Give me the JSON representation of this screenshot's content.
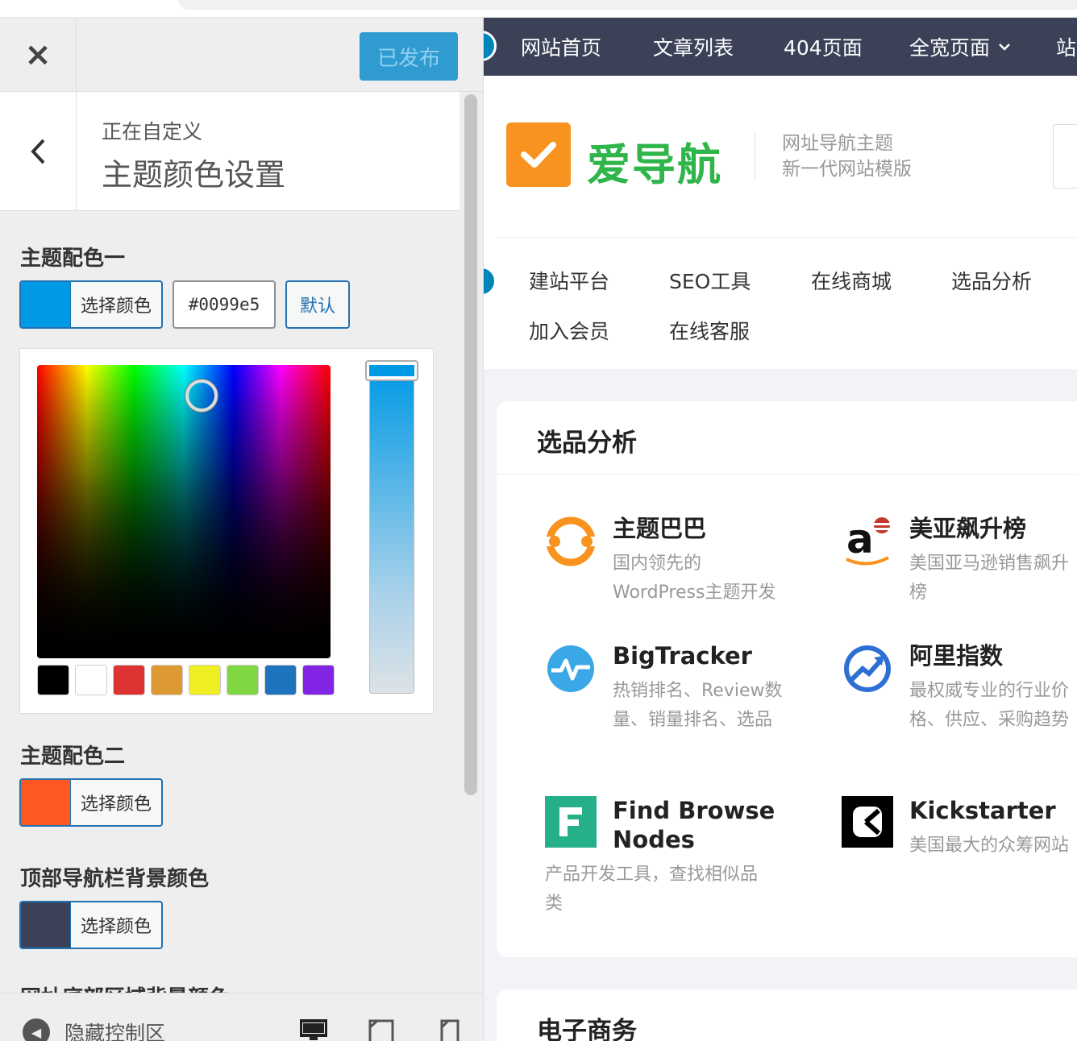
{
  "customizer": {
    "close_icon": "×",
    "publish_label": "已发布",
    "section_pre": "正在自定义",
    "section_title": "主题颜色设置",
    "color1": {
      "title": "主题配色一",
      "button_label": "选择颜色",
      "swatch": "#0099e5",
      "hex_value": "#0099e5",
      "default_label": "默认",
      "palette": [
        "#000000",
        "#ffffff",
        "#dd3333",
        "#dd9933",
        "#eeee22",
        "#81d742",
        "#1e73be",
        "#8224e3"
      ]
    },
    "color2": {
      "title": "主题配色二",
      "button_label": "选择颜色",
      "swatch": "#ff5722"
    },
    "color3": {
      "title": "顶部导航栏背景颜色",
      "button_label": "选择颜色",
      "swatch": "#3b4258"
    },
    "color4": {
      "title": "网址底部区域背景颜色"
    },
    "footer": {
      "hide_label": "隐藏控制区"
    }
  },
  "preview": {
    "nav": [
      "网站首页",
      "文章列表",
      "404页面",
      "全宽页面",
      "站"
    ],
    "logo_text": "爱导航",
    "slogan": [
      "网址导航主题",
      "新一代网站模版"
    ],
    "quick_links": [
      "建站平台",
      "SEO工具",
      "在线商城",
      "选品分析",
      "加入会员",
      "在线客服"
    ],
    "card1": {
      "title": "选品分析",
      "sites": [
        {
          "name": "主题巴巴",
          "desc": [
            "国内领先的",
            "WordPress主题开发"
          ],
          "icon": "zhutibaba-icon"
        },
        {
          "name": "美亚飙升榜",
          "desc": [
            "美国亚马逊销售飙升",
            "榜"
          ],
          "icon": "amazon-icon"
        },
        {
          "name": "BigTracker",
          "desc": [
            "热销排名、Review数",
            "量、销量排名、选品"
          ],
          "icon": "bigtracker-icon"
        },
        {
          "name": "阿里指数",
          "desc": [
            "最权威专业的行业价",
            "格、供应、采购趋势"
          ],
          "icon": "alizhishu-icon"
        },
        {
          "name": [
            "Find Browse",
            "Nodes"
          ],
          "desc": [
            "产品开发工具，查找相似品",
            "类"
          ],
          "icon": "findbrowsenodes-icon"
        },
        {
          "name": "Kickstarter",
          "desc": [
            "美国最大的众筹网站"
          ],
          "icon": "kickstarter-icon"
        }
      ]
    },
    "card2": {
      "title": "电子商务"
    }
  }
}
